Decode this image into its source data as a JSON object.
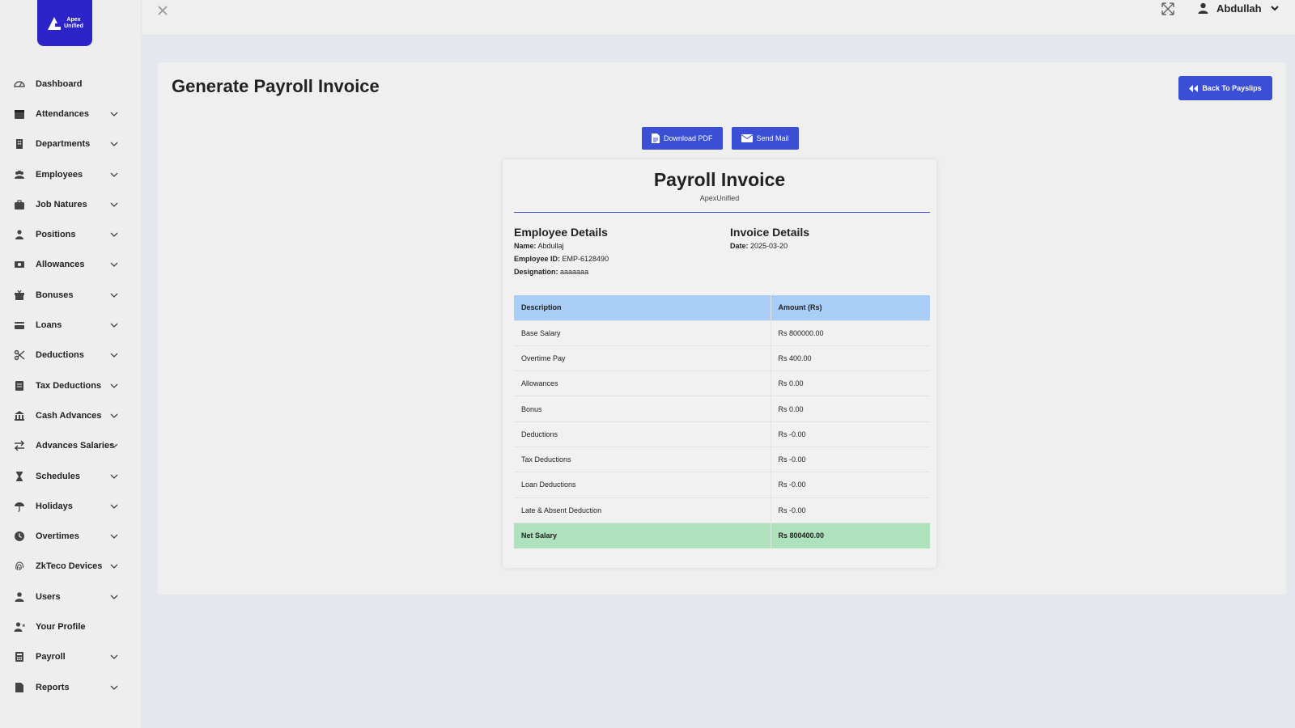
{
  "logo": {
    "text_line1": "Apex",
    "text_line2": "Unified"
  },
  "sidebar": {
    "items": [
      {
        "label": "Dashboard",
        "icon": "dashboard-icon",
        "expandable": false
      },
      {
        "label": "Attendances",
        "icon": "calendar-icon",
        "expandable": true
      },
      {
        "label": "Departments",
        "icon": "building-icon",
        "expandable": true
      },
      {
        "label": "Employees",
        "icon": "users-icon",
        "expandable": true
      },
      {
        "label": "Job Natures",
        "icon": "briefcase-icon",
        "expandable": true
      },
      {
        "label": "Positions",
        "icon": "user-tie-icon",
        "expandable": true
      },
      {
        "label": "Allowances",
        "icon": "money-icon",
        "expandable": true
      },
      {
        "label": "Bonuses",
        "icon": "gift-icon",
        "expandable": true
      },
      {
        "label": "Loans",
        "icon": "credit-card-icon",
        "expandable": true
      },
      {
        "label": "Deductions",
        "icon": "scissors-icon",
        "expandable": true
      },
      {
        "label": "Tax Deductions",
        "icon": "receipt-icon",
        "expandable": true
      },
      {
        "label": "Cash Advances",
        "icon": "bank-icon",
        "expandable": true
      },
      {
        "label": "Advances Salaries",
        "icon": "exchange-icon",
        "expandable": true
      },
      {
        "label": "Schedules",
        "icon": "hourglass-icon",
        "expandable": true
      },
      {
        "label": "Holidays",
        "icon": "umbrella-icon",
        "expandable": true
      },
      {
        "label": "Overtimes",
        "icon": "clock-icon",
        "expandable": true
      },
      {
        "label": "ZkTeco Devices",
        "icon": "fingerprint-icon",
        "expandable": true
      },
      {
        "label": "Users",
        "icon": "user-icon",
        "expandable": true
      },
      {
        "label": "Your Profile",
        "icon": "user-profile-icon",
        "expandable": false
      },
      {
        "label": "Payroll",
        "icon": "calculator-icon",
        "expandable": true
      },
      {
        "label": "Reports",
        "icon": "file-icon",
        "expandable": true
      }
    ]
  },
  "topbar": {
    "user_name": "Abdullah"
  },
  "page": {
    "title": "Generate Payroll Invoice",
    "back_button": "Back To Payslips",
    "download_button": "Download PDF",
    "mail_button": "Send Mail"
  },
  "invoice": {
    "title": "Payroll Invoice",
    "company": "ApexUnified",
    "employee_heading": "Employee Details",
    "invoice_heading": "Invoice Details",
    "name_label": "Name:",
    "name_value": "Abdullaj",
    "emp_id_label": "Employee ID:",
    "emp_id_value": "EMP-6128490",
    "designation_label": "Designation:",
    "designation_value": "aaaaaaa",
    "date_label": "Date:",
    "date_value": "2025-03-20",
    "table_headers": [
      "Description",
      "Amount (Rs)"
    ],
    "rows": [
      {
        "description": "Base Salary",
        "amount": "Rs 800000.00"
      },
      {
        "description": "Overtime Pay",
        "amount": "Rs 400.00"
      },
      {
        "description": "Allowances",
        "amount": "Rs 0.00"
      },
      {
        "description": "Bonus",
        "amount": "Rs 0.00"
      },
      {
        "description": "Deductions",
        "amount": "Rs -0.00"
      },
      {
        "description": "Tax Deductions",
        "amount": "Rs -0.00"
      },
      {
        "description": "Loan Deductions",
        "amount": "Rs -0.00"
      },
      {
        "description": "Late & Absent Deduction",
        "amount": "Rs -0.00"
      }
    ],
    "net": {
      "description": "Net Salary",
      "amount": "Rs 800400.00"
    }
  },
  "colors": {
    "accent": "#3a4ed6",
    "logo_bg": "#2c24c9",
    "table_header": "#a8cdf7",
    "net_row": "#aee2bd"
  }
}
